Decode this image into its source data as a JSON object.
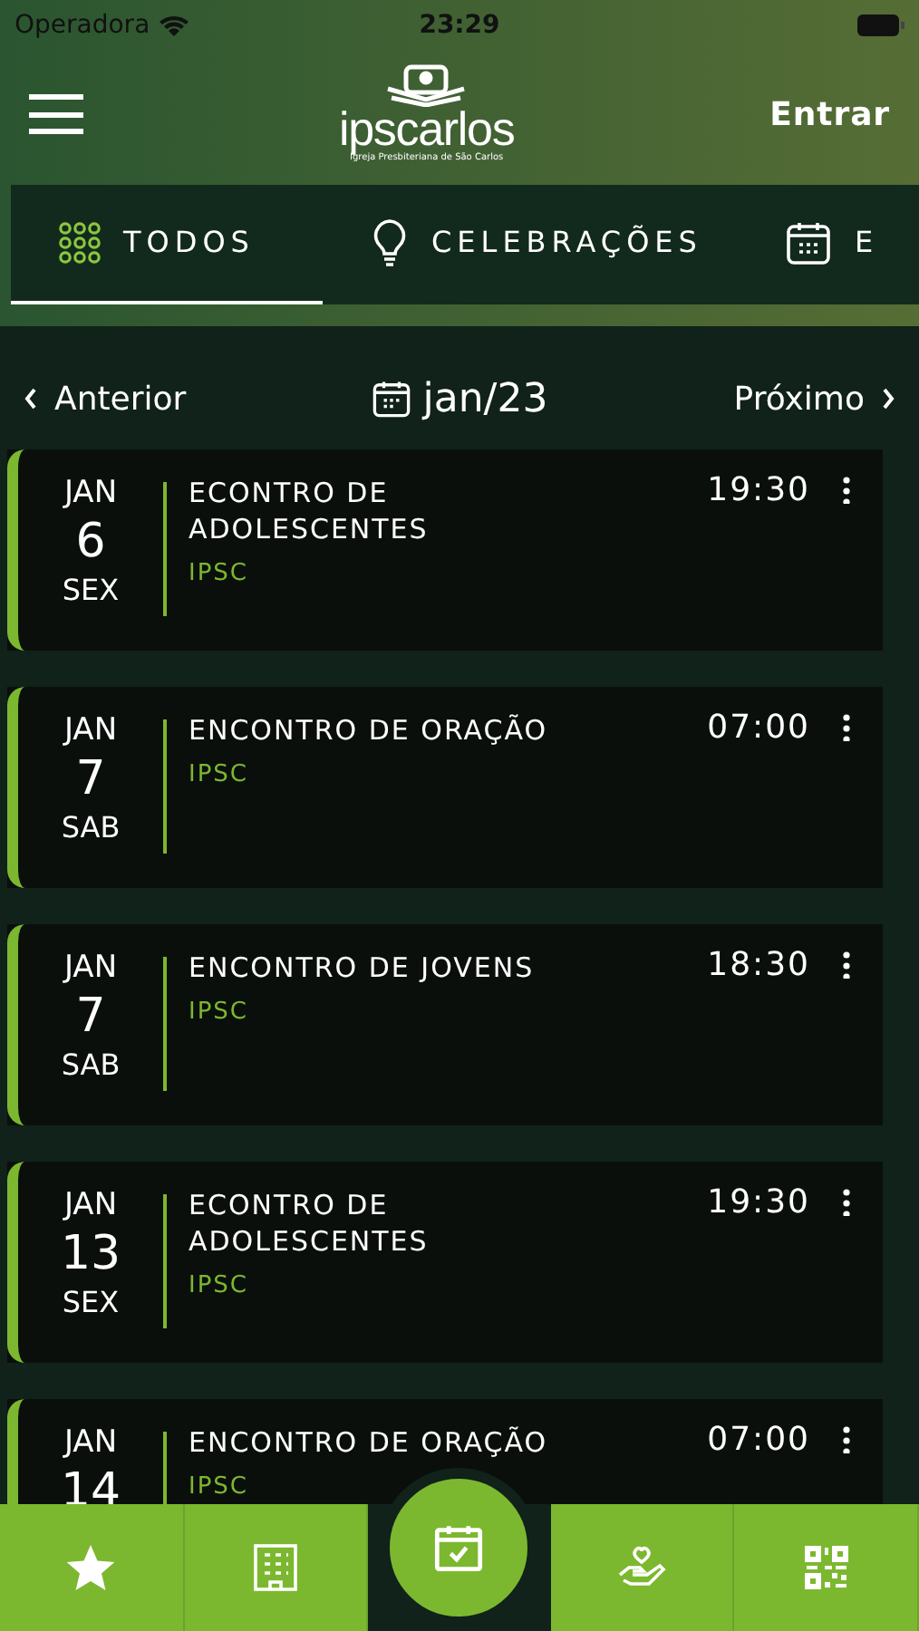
{
  "status_bar": {
    "carrier": "Operadora",
    "time": "23:29"
  },
  "header": {
    "logo_text": "ipscarlos",
    "logo_subtitle": "Igreja Presbiteriana de São Carlos",
    "login": "Entrar"
  },
  "tabs": [
    {
      "label": "TODOS",
      "kind": "grid",
      "selected": true
    },
    {
      "label": "CELEBRAÇÕES",
      "kind": "bulb",
      "selected": false
    },
    {
      "label": "E",
      "kind": "calendar",
      "selected": false
    }
  ],
  "month_nav": {
    "previous": "Anterior",
    "month": "jan/23",
    "next": "Próximo"
  },
  "events": [
    {
      "month": "JAN",
      "day": "6",
      "weekday": "SEX",
      "title": "ECONTRO DE ADOLESCENTES",
      "place": "IPSC",
      "time": "19:30"
    },
    {
      "month": "JAN",
      "day": "7",
      "weekday": "SAB",
      "title": "ENCONTRO DE ORAÇÃO",
      "place": "IPSC",
      "time": "07:00"
    },
    {
      "month": "JAN",
      "day": "7",
      "weekday": "SAB",
      "title": "ENCONTRO DE JOVENS",
      "place": "IPSC",
      "time": "18:30"
    },
    {
      "month": "JAN",
      "day": "13",
      "weekday": "SEX",
      "title": "ECONTRO DE ADOLESCENTES",
      "place": "IPSC",
      "time": "19:30"
    },
    {
      "month": "JAN",
      "day": "14",
      "title": "ENCONTRO DE ORAÇÃO",
      "place": "IPSC",
      "time": "07:00"
    }
  ],
  "bottom_nav": [
    {
      "kind": "star",
      "selected": false
    },
    {
      "kind": "building",
      "selected": false
    },
    {
      "kind": "calendar",
      "selected": true
    },
    {
      "kind": "charity",
      "selected": false
    },
    {
      "kind": "qr",
      "selected": false
    }
  ]
}
